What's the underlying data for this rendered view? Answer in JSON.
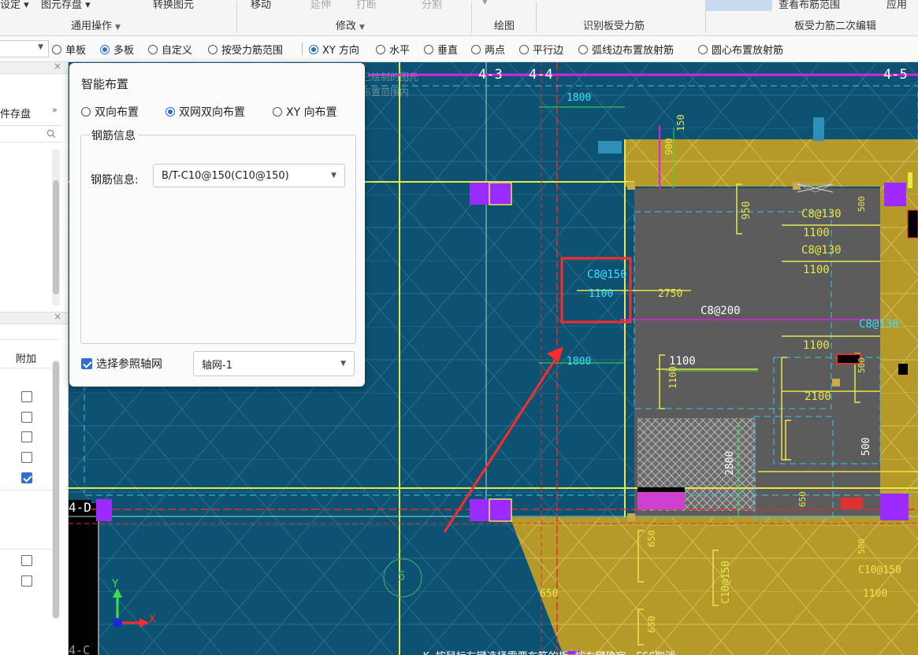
{
  "ribbon": {
    "top_labels": [
      "设定 ▾",
      "图元存盘 ▾",
      "转换图元",
      "移动",
      "延伸",
      "打断",
      "分割",
      "▾"
    ],
    "groups": [
      "通用操作",
      "修改",
      "绘图",
      "识别板受力筋",
      "板受力筋二次编辑"
    ],
    "right_labels": [
      "查看布筋范围",
      "应用"
    ]
  },
  "optbar": {
    "select_value": "",
    "options": [
      {
        "label": "单板",
        "checked": false
      },
      {
        "label": "多板",
        "checked": true
      },
      {
        "label": "自定义",
        "checked": false
      },
      {
        "label": "按受力筋范围",
        "checked": false
      },
      {
        "label": "XY 方向",
        "checked": true
      },
      {
        "label": "水平",
        "checked": false
      },
      {
        "label": "垂直",
        "checked": false
      },
      {
        "label": "两点",
        "checked": false
      },
      {
        "label": "平行边",
        "checked": false
      },
      {
        "label": "弧线边布置放射筋",
        "checked": false
      },
      {
        "label": "圆心布置放射筋",
        "checked": false
      }
    ]
  },
  "left_panel": {
    "tab_label": "件存盘",
    "more_icon": "»",
    "column_header": "附加",
    "checkboxes": [
      false,
      false,
      false,
      false,
      true,
      false,
      false
    ]
  },
  "dialog": {
    "title": "智能布置",
    "layout_options": [
      {
        "label": "双向布置",
        "checked": false
      },
      {
        "label": "双网双向布置",
        "checked": true
      },
      {
        "label": "XY 向布置",
        "checked": false
      }
    ],
    "group_title": "钢筋信息",
    "rebar_label": "钢筋信息:",
    "rebar_value": "B/T-C10@150(C10@150)",
    "ref_axis_label": "选择参照轴网",
    "ref_axis_checked": true,
    "ref_axis_value": "轴网-1"
  },
  "cad": {
    "axis_labels": [
      "4-3",
      "4-4",
      "4-5",
      "4-D",
      "4-C"
    ],
    "dims": [
      "1800",
      "1800",
      "900",
      "150",
      "950",
      "500",
      "1100",
      "1100",
      "1100",
      "2750",
      "1100",
      "1100",
      "1100",
      "2100",
      "2800",
      "500",
      "500",
      "650",
      "650",
      "650",
      "650",
      "1100",
      "500"
    ],
    "rebar_labels": [
      "C8@150",
      "C8@200",
      "C8@130",
      "C8@130",
      "C8@130",
      "C10@150",
      "C10@150"
    ],
    "faded_text": [
      "已绘制的图元",
      "布置范围内"
    ],
    "circle_label": "5",
    "axis_x": "X",
    "axis_y": "Y",
    "status_hint": "K 按鼠标左键选择需要布筋的板,按右键确定，ESC取消"
  },
  "colors": {
    "canvas_bg": "#0d5272",
    "slab_gold": "#b59a2a",
    "slab_gray": "#5c5c5c",
    "column_purple": "#9b2bff",
    "axis_red": "#e03030",
    "grid_yellow": "#e8e84a",
    "highlight_red": "#ff2a2a"
  }
}
